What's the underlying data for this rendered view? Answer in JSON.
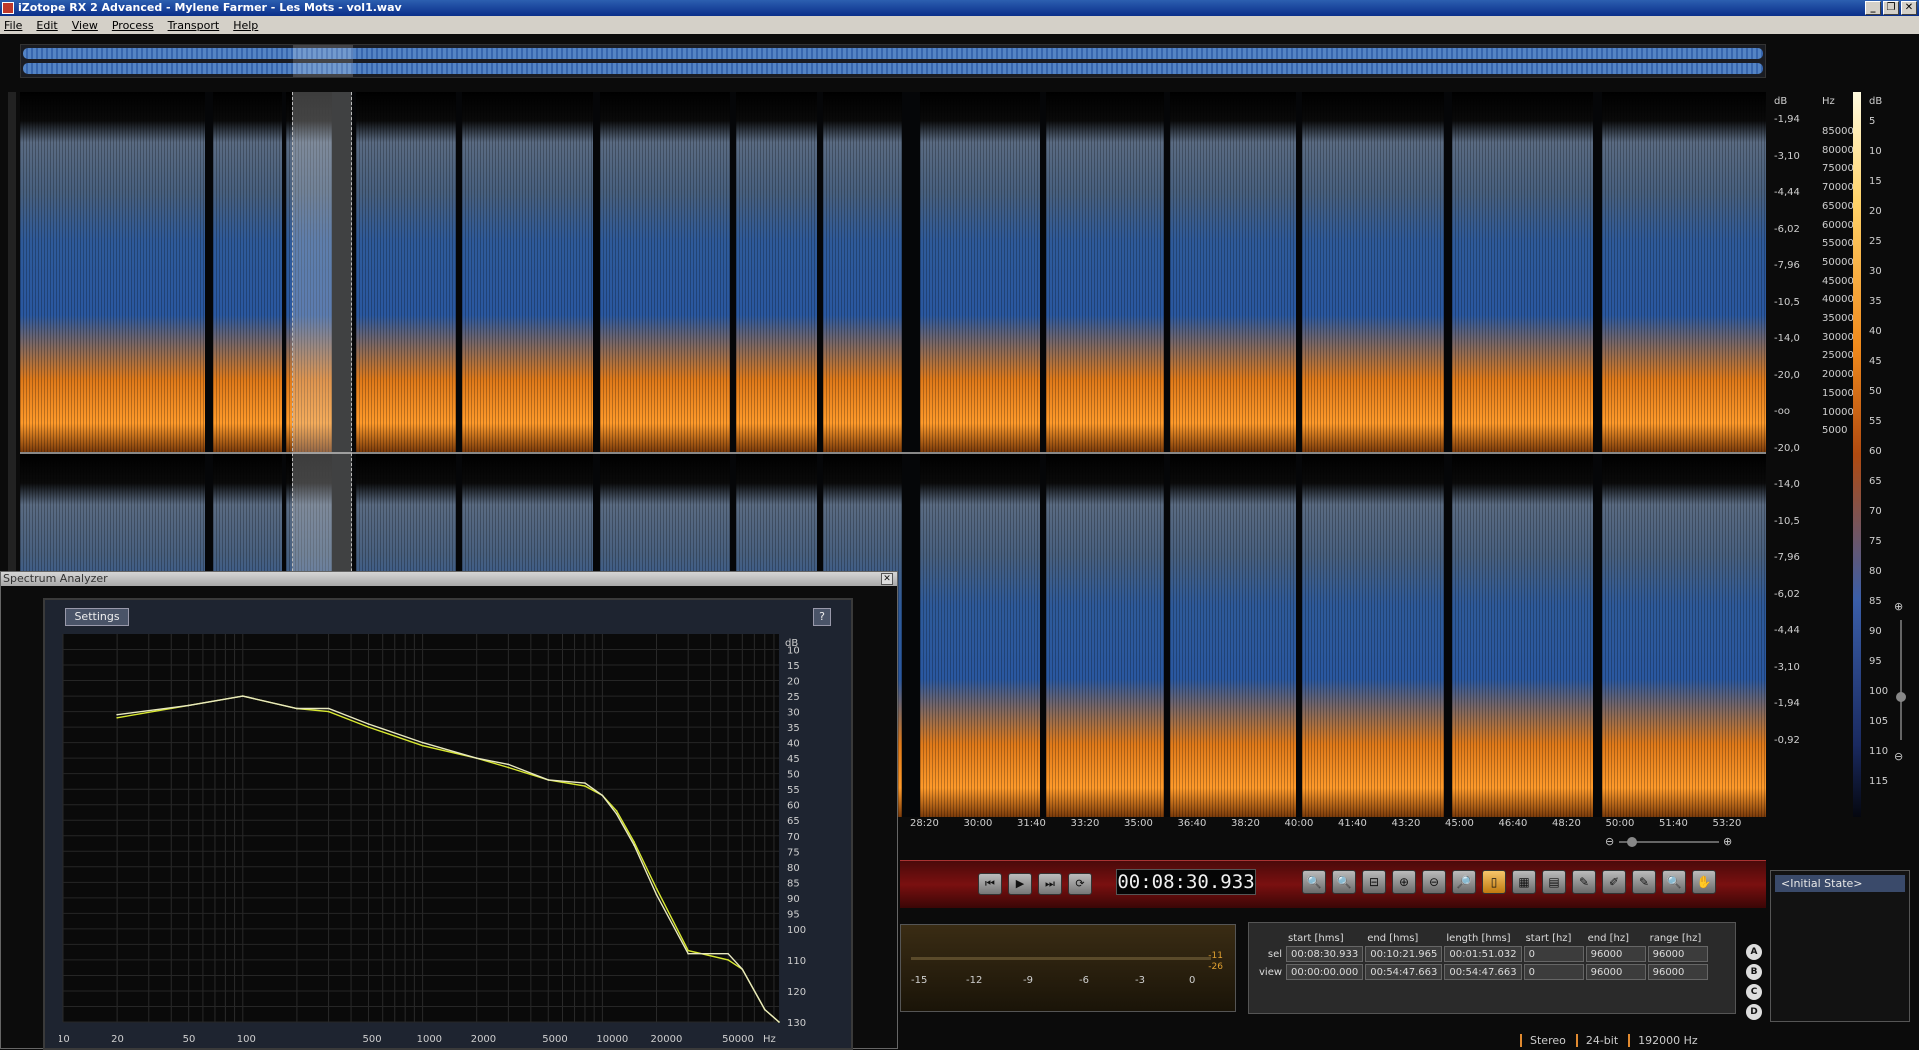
{
  "window": {
    "title": "iZotope RX 2 Advanced - Mylene Farmer - Les Mots - vol1.wav",
    "controls": [
      "_",
      "❐",
      "✕"
    ]
  },
  "menu": [
    "File",
    "Edit",
    "View",
    "Process",
    "Transport",
    "Help"
  ],
  "scales": {
    "db_label": "dB",
    "hz_label": "Hz",
    "color_label": "dB",
    "db_ticks": [
      "-1,94",
      "-3,10",
      "-4,44",
      "-6,02",
      "-7,96",
      "-10,5",
      "-14,0",
      "-20,0",
      "-oo",
      "-20,0",
      "-14,0",
      "-10,5",
      "-7,96",
      "-6,02",
      "-4,44",
      "-3,10",
      "-1,94",
      "-0,92"
    ],
    "hz_ticks": [
      "85000",
      "80000",
      "75000",
      "70000",
      "65000",
      "60000",
      "55000",
      "50000",
      "45000",
      "40000",
      "35000",
      "30000",
      "25000",
      "20000",
      "15000",
      "10000",
      "5000"
    ],
    "color_ticks": [
      "5",
      "10",
      "15",
      "20",
      "25",
      "30",
      "35",
      "40",
      "45",
      "50",
      "55",
      "60",
      "65",
      "70",
      "75",
      "80",
      "85",
      "90",
      "95",
      "100",
      "105",
      "110",
      "115"
    ]
  },
  "time_axis": [
    "28:20",
    "30:00",
    "31:40",
    "33:20",
    "35:00",
    "36:40",
    "38:20",
    "40:00",
    "41:40",
    "43:20",
    "45:00",
    "46:40",
    "48:20",
    "50:00",
    "51:40",
    "53:20"
  ],
  "transport": {
    "timecode": "00:08:30.933",
    "buttons": [
      "⏮",
      "▶",
      "⏭",
      "⟳"
    ]
  },
  "tools": [
    "🔍",
    "🔍",
    "⊟",
    "⊕",
    "⊖",
    "🔎",
    "▯",
    "▦",
    "▤",
    "✎",
    "✐",
    "✎",
    "🔍",
    "✋"
  ],
  "meter": {
    "labels": [
      "-15",
      "-12",
      "-9",
      "-6",
      "-3",
      "0"
    ],
    "peaks": [
      "-11",
      "-26"
    ]
  },
  "selection_info": {
    "headers": [
      "start [hms]",
      "end [hms]",
      "length [hms]",
      "start [hz]",
      "end [hz]",
      "range [hz]"
    ],
    "rows": [
      {
        "label": "sel",
        "values": [
          "00:08:30.933",
          "00:10:21.965",
          "00:01:51.032",
          "0",
          "96000",
          "96000"
        ]
      },
      {
        "label": "view",
        "values": [
          "00:00:00.000",
          "00:54:47.663",
          "00:54:47.663",
          "0",
          "96000",
          "96000"
        ]
      }
    ]
  },
  "abcd": [
    "A",
    "B",
    "C",
    "D"
  ],
  "history": {
    "items": [
      "<Initial State>"
    ]
  },
  "status": {
    "items": [
      "Stereo",
      "24-bit",
      "192000 Hz"
    ]
  },
  "spectrum_analyzer": {
    "title": "Spectrum Analyzer",
    "settings_label": "Settings",
    "help_label": "?",
    "close_label": "✕",
    "db_unit": "dB",
    "db_ticks": [
      "10",
      "15",
      "20",
      "25",
      "30",
      "35",
      "40",
      "45",
      "50",
      "55",
      "60",
      "65",
      "70",
      "75",
      "80",
      "85",
      "90",
      "95",
      "100",
      "110",
      "120",
      "130"
    ],
    "hz_ticks": [
      "10",
      "20",
      "50",
      "100",
      "500",
      "1000",
      "2000",
      "5000",
      "10000",
      "20000",
      "50000",
      "Hz"
    ]
  },
  "chart_data": {
    "type": "line",
    "xlabel": "Hz",
    "ylabel": "dB",
    "x_scale": "log",
    "ylim": [
      130,
      5
    ],
    "series": [
      {
        "x": [
          20,
          50,
          100,
          200,
          300,
          500,
          1000,
          2000,
          3000,
          5000,
          8000,
          10000,
          12000,
          15000,
          20000,
          30000,
          50000,
          60000,
          80000,
          96000
        ],
        "values": [
          32,
          28,
          25,
          29,
          30,
          35,
          41,
          45,
          48,
          52,
          54,
          57,
          62,
          72,
          87,
          107,
          110,
          113,
          126,
          130
        ]
      },
      {
        "x": [
          20,
          50,
          100,
          200,
          300,
          500,
          1000,
          2000,
          3000,
          5000,
          8000,
          10000,
          12000,
          15000,
          20000,
          30000,
          50000,
          60000,
          80000,
          96000
        ],
        "values": [
          31,
          28,
          25,
          29,
          29,
          34,
          40,
          45,
          47,
          52,
          53,
          57,
          63,
          73,
          89,
          108,
          108,
          113,
          126,
          130
        ]
      }
    ],
    "colors": [
      "#d8e830",
      "#e8e8c0"
    ]
  }
}
